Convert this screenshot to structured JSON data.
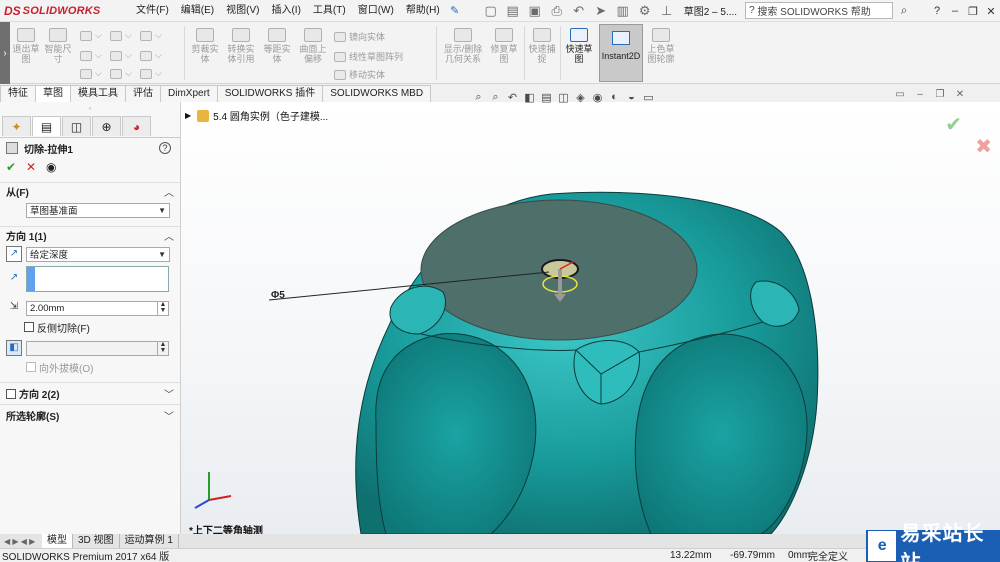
{
  "app": {
    "logo_text": "SOLIDWORKS",
    "logo_mark": "DS"
  },
  "menu": [
    "文件(F)",
    "编辑(E)",
    "视图(V)",
    "插入(I)",
    "工具(T)",
    "窗口(W)",
    "帮助(H)"
  ],
  "document_title": "草图2 – 5....",
  "search": {
    "placeholder": "搜索 SOLIDWORKS 帮助"
  },
  "ribbon": {
    "buttons": [
      "退出草图",
      "智能尺寸",
      "剪裁实体",
      "转换实体引用",
      "等距实体",
      "曲面上偏移",
      "显示/删除几何关系",
      "修复草图",
      "快速捕捉",
      "快速草图",
      "Instant2D",
      "上色草图轮廓"
    ],
    "small": [
      "镜向实体",
      "线性草图阵列",
      "移动实体"
    ]
  },
  "tabs": [
    "特征",
    "草图",
    "模具工具",
    "评估",
    "DimXpert",
    "SOLIDWORKS 插件",
    "SOLIDWORKS MBD"
  ],
  "active_tab": "草图",
  "property_manager": {
    "title": "切除-拉伸1",
    "help": "?",
    "from": {
      "label": "从(F)",
      "value": "草图基准面"
    },
    "direction1": {
      "label": "方向 1(1)",
      "end_condition": "给定深度",
      "depth": "2.00mm",
      "flip_side": "反侧切除(F)",
      "draft_outward": "向外拔模(O)"
    },
    "direction2": {
      "label": "方向 2(2)"
    },
    "selected_contours": {
      "label": "所选轮廓(S)"
    }
  },
  "viewport": {
    "tree_item": "5.4 圆角实例（色子建模...",
    "view_orientation": "*上下二等角轴测",
    "dimension": "Φ5",
    "model_color": "#1a9a9a"
  },
  "bottom_tabs": [
    "模型",
    "3D 视图",
    "运动算例 1"
  ],
  "status": {
    "product": "SOLIDWORKS Premium 2017 x64 版",
    "x": "13.22mm",
    "y": "-69.79mm",
    "z": "0mm",
    "state": "完全定义"
  },
  "watermark": "易采站长站"
}
